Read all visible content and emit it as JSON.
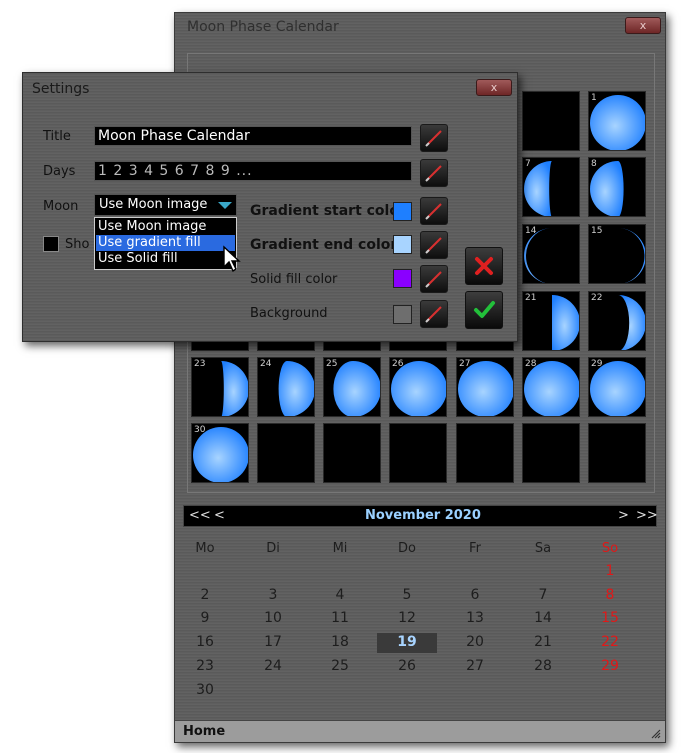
{
  "main_window": {
    "title": "Moon Phase Calendar",
    "close_label": "x",
    "calendar": {
      "prev_year": "<<",
      "prev_month": "<",
      "month_title": "November 2020",
      "next_month": ">",
      "next_year": ">>",
      "weekdays": [
        "Mo",
        "Di",
        "Mi",
        "Do",
        "Fr",
        "Sa",
        "So"
      ],
      "weeks": [
        [
          "",
          "",
          "",
          "",
          "",
          "",
          "1"
        ],
        [
          "2",
          "3",
          "4",
          "5",
          "6",
          "7",
          "8"
        ],
        [
          "9",
          "10",
          "11",
          "12",
          "13",
          "14",
          "15"
        ],
        [
          "16",
          "17",
          "18",
          "19",
          "20",
          "21",
          "22"
        ],
        [
          "23",
          "24",
          "25",
          "26",
          "27",
          "28",
          "29"
        ],
        [
          "30",
          "",
          "",
          "",
          "",
          "",
          ""
        ]
      ],
      "today": "19"
    },
    "moon_days": [
      "1",
      "7",
      "8",
      "14",
      "15",
      "21",
      "22",
      "23",
      "24",
      "25",
      "26",
      "27",
      "28",
      "29",
      "30"
    ],
    "status": "Home"
  },
  "settings": {
    "title": "Settings",
    "close_label": "x",
    "title_label": "Title",
    "title_value": "Moon Phase Calendar",
    "days_label": "Days",
    "days_value": "1 2 3 4 5 6 7 8 9 ...",
    "moon_label": "Moon",
    "moon_selected": "Use Moon image",
    "moon_options": [
      "Use Moon image",
      "Use gradient fill",
      "Use Solid fill"
    ],
    "moon_highlighted": "Use gradient fill",
    "show_label": "Sho",
    "gradient_start_label": "Gradient start color",
    "gradient_end_label": "Gradient end color",
    "solid_fill_label": "Solid fill color",
    "background_label": "Background",
    "colors": {
      "gradient_start": "#1e7fff",
      "gradient_end": "#a8d4ff",
      "solid_fill": "#8a00ff",
      "background": "#6e6e6e"
    }
  }
}
